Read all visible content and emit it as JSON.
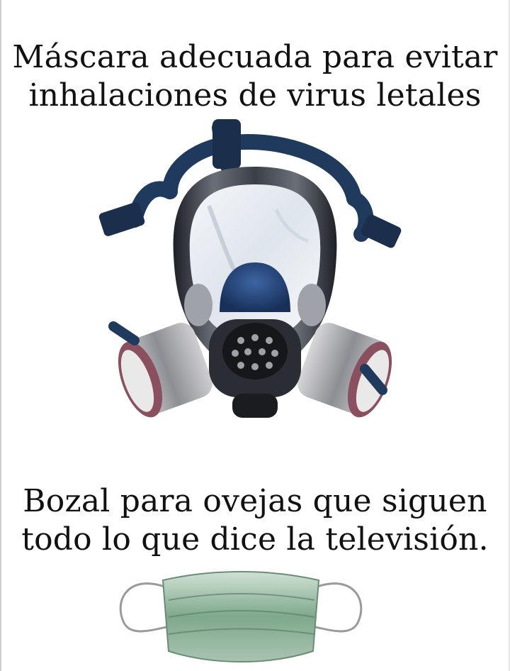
{
  "top_caption": {
    "line1": "Máscara adecuada para evitar",
    "line2": "inhalaciones de virus letales"
  },
  "bottom_caption": {
    "line1": "Bozal para ovejas que siguen",
    "line2": "todo lo que dice la televisión."
  },
  "images": {
    "top": "gas-mask-icon",
    "bottom": "surgical-mask-icon"
  },
  "colors": {
    "background": "#ffffff",
    "text": "#111111",
    "strap_blue": "#1f3a5c",
    "mask_blue": "#2b4a7a",
    "frame_dark": "#2a2d33",
    "filter_metal": "#a9a9ad",
    "filter_ring": "#8a5060",
    "surgical_green": "#7fa88c"
  }
}
